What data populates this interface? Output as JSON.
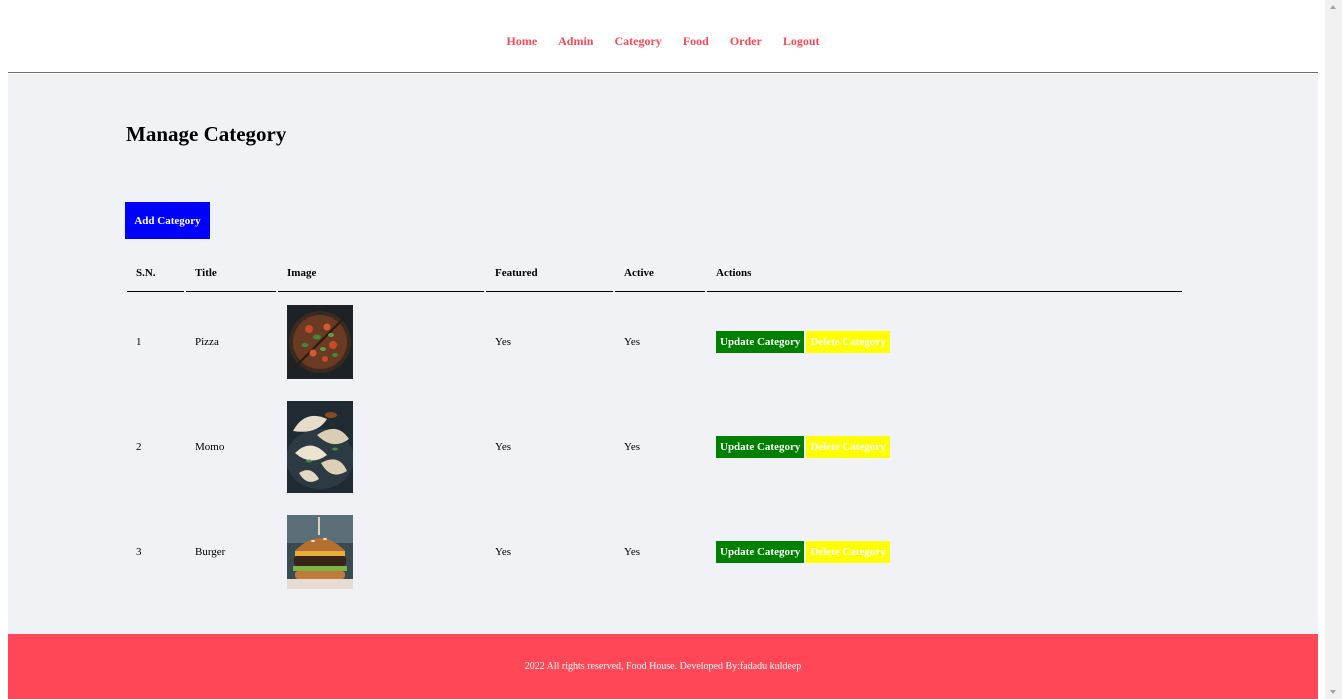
{
  "nav": {
    "items": [
      {
        "label": "Home"
      },
      {
        "label": "Admin"
      },
      {
        "label": "Category"
      },
      {
        "label": "Food"
      },
      {
        "label": "Order"
      },
      {
        "label": "Logout"
      }
    ]
  },
  "main": {
    "title": "Manage Category",
    "add_button_label": "Add Category"
  },
  "table": {
    "headers": [
      "S.N.",
      "Title",
      "Image",
      "Featured",
      "Active",
      "Actions"
    ],
    "rows": [
      {
        "sn": "1",
        "title": "Pizza",
        "featured": "Yes",
        "active": "Yes",
        "image_icon": "pizza-photo"
      },
      {
        "sn": "2",
        "title": "Momo",
        "featured": "Yes",
        "active": "Yes",
        "image_icon": "momo-photo"
      },
      {
        "sn": "3",
        "title": "Burger",
        "featured": "Yes",
        "active": "Yes",
        "image_icon": "burger-photo"
      }
    ],
    "update_label": "Update Category",
    "delete_label": "Delete Category"
  },
  "footer": {
    "text": "2022 All rights reserved, Food House. Developed By:fadadu kuldeep"
  },
  "colors": {
    "accent": "#ff4757",
    "content_bg": "#f1f2f6",
    "add_button": "#0000ff",
    "update_button": "#008000",
    "delete_button": "#ffff00"
  }
}
